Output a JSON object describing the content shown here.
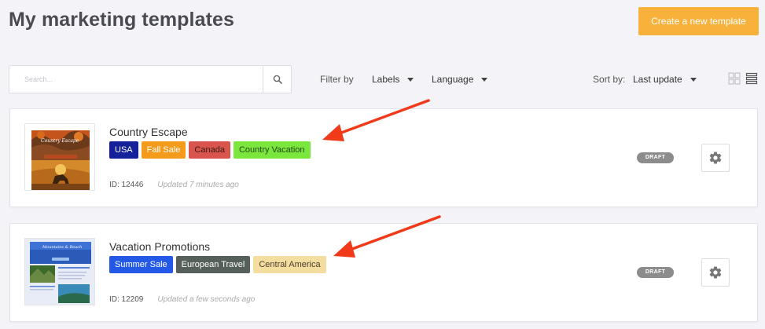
{
  "page": {
    "title": "My marketing templates",
    "create_button": "Create a new template"
  },
  "filters": {
    "search_placeholder": "Search...",
    "filter_by_label": "Filter by",
    "labels_dropdown": "Labels",
    "language_dropdown": "Language",
    "sort_by_label": "Sort by:",
    "sort_value": "Last update"
  },
  "templates": [
    {
      "name": "Country Escape",
      "thumbnail_caption": "Country Escape",
      "tags": [
        {
          "label": "USA",
          "color": "#14219a"
        },
        {
          "label": "Fall Sale",
          "color": "#f59b1c"
        },
        {
          "label": "Canada",
          "color": "#d9544d"
        },
        {
          "label": "Country Vacation",
          "color": "#7be63c"
        }
      ],
      "id_text": "ID: 12446",
      "updated": "Updated 7 minutes ago",
      "status": "DRAFT"
    },
    {
      "name": "Vacation Promotions",
      "thumbnail_caption": "Mountains & Beach",
      "tags": [
        {
          "label": "Summer Sale",
          "color": "#2359e6"
        },
        {
          "label": "European Travel",
          "color": "#56605a"
        },
        {
          "label": "Central America",
          "color": "#f3dea0"
        }
      ],
      "id_text": "ID: 12209",
      "updated": "Updated a few seconds ago",
      "status": "DRAFT"
    }
  ],
  "colors": {
    "accent": "#f8b23c",
    "annotation_arrow": "#f03a1a"
  }
}
